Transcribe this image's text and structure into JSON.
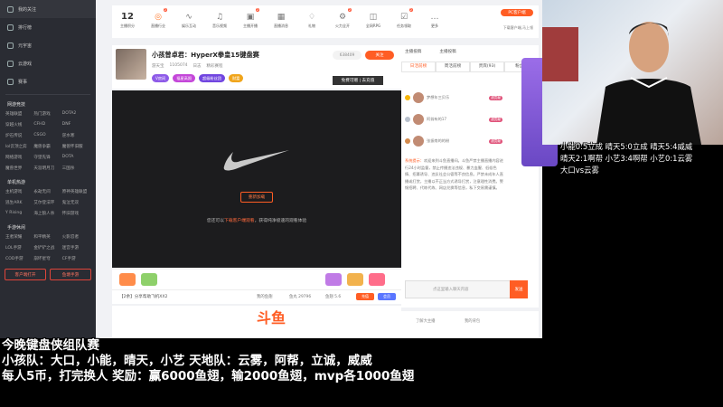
{
  "sidebar": {
    "nav": [
      {
        "label": "我的关注"
      },
      {
        "label": "排行榜"
      },
      {
        "label": "元宇宙"
      },
      {
        "label": "云游戏"
      },
      {
        "label": "赛事"
      }
    ],
    "sections": [
      {
        "title": "网游竞技",
        "items": [
          "英雄联盟",
          "热门游戏",
          "DOTA2",
          "穿越火线",
          "CFHD",
          "DNF",
          "炉石传说",
          "CSGO",
          "逆水寒",
          "lol云顶之弈",
          "魔兽争霸",
          "魔兽怀旧服",
          "网络游戏",
          "守望先锋",
          "DOTA",
          "魔兽世界",
          "天涯明月刀",
          "三国杀"
        ]
      },
      {
        "title": "单机热游",
        "items": [
          "主机游戏",
          "永劫无间",
          "原神英雄联盟",
          "逃生ARK",
          "艾尔登法环",
          "鬼泣无双",
          "Y Rising",
          "海上狼人杀",
          "怀旧游戏"
        ]
      },
      {
        "title": "手游休闲",
        "items": [
          "王者荣耀",
          "和平精英",
          "火影忍者",
          "LOL手游",
          "金铲铲之战",
          "迷宫手游",
          "COD手游",
          "崩坏星穹",
          "CF手游"
        ]
      }
    ],
    "buttons": [
      "客户端打开",
      "鱼塘手游"
    ]
  },
  "topbar": {
    "items": [
      {
        "glyph": "12",
        "label": "主播积分",
        "badge": ""
      },
      {
        "glyph": "◎",
        "label": "直播行业",
        "badge": "2",
        "orange": true
      },
      {
        "glyph": "∿",
        "label": "娱乐互动",
        "badge": ""
      },
      {
        "glyph": "♫",
        "label": "音乐视频",
        "badge": ""
      },
      {
        "glyph": "▣",
        "label": "主播开播",
        "badge": "2"
      },
      {
        "glyph": "▦",
        "label": "直播消息",
        "badge": ""
      },
      {
        "glyph": "♢",
        "label": "礼物",
        "badge": ""
      },
      {
        "glyph": "⚙",
        "label": "火力全开",
        "badge": "2"
      },
      {
        "glyph": "◫",
        "label": "全网RPG",
        "badge": ""
      },
      {
        "glyph": "☑",
        "label": "任务领取",
        "badge": "2"
      },
      {
        "glyph": "…",
        "label": "更多",
        "badge": ""
      }
    ],
    "pc_download": "PC客户端",
    "pc_download_sub": "下载客户端,马上领"
  },
  "room": {
    "title": "小孩曾卓君：HyperX拳皇15键盘赛",
    "sub_items": [
      "游天宝",
      "1105074",
      "日志",
      "精彩赛程"
    ],
    "tags": [
      "V房间",
      "福星高照",
      "超级粉丝团",
      "财富"
    ],
    "fans": "638409",
    "follow": "关注",
    "freegift": "免费可赠 | 去充值"
  },
  "player": {
    "retry": "重新加载",
    "msg_pre": "您还可以",
    "msg_link": "下载客户端观看",
    "msg_post": "，获得纯净极速的观看体验"
  },
  "giftbar": {
    "ticker": "【2余】分享帮助飞机XX2",
    "stats": [
      "我的鱼翅",
      "鱼丸 29796",
      "鱼翅 5.6",
      "充值",
      "会员"
    ]
  },
  "chat": {
    "head": [
      "主播投稿",
      "主播投稿"
    ],
    "tabs": [
      "日活前榜",
      "周活前榜",
      "贵宾(93)",
      "粉丝团"
    ],
    "ranks": [
      {
        "name": "梦想年三贝乐",
        "pill": "超贡献"
      },
      {
        "name": "阿翁有的17",
        "pill": "超贡献"
      },
      {
        "name": "张振南的的粉",
        "pill": "超贡献"
      }
    ],
    "sys_title": "系统提示：",
    "sys_text": "欢迎来到斗鱼直播间。斗鱼严禁主播直播内容进行24小时监督，禁止传播违法违规、暴力血腥、低俗色情、招募诱导、违反社会公德等不良信息。严禁未成年人直播或打赏，主播以不正当方式诱导打赏，注意理性消费。警惕招聘、代练代练、网店兑换等信息，私下交易需谨慎。",
    "input_placeholder": "点这里输入聊天内容",
    "send": "发送",
    "bottom_left": "了解大主播",
    "bottom_mid": "我的背包"
  },
  "ad": {
    "brand": "斗鱼"
  },
  "lyric": [
    "小能0:5立成  晴天5:0立成  晴天5:4威威",
    "晴天2:1啊帮  小艺3:4啊帮  小艺0:1云雾",
    "大口vs云雾"
  ],
  "overlay": [
    "今晚键盘侠组队赛",
    "小孩队：大口，小能，晴天，小艺  天地队：云雾，阿帮，立诚，威威",
    "每人5币，打完换人  奖励：赢6000鱼翅，输2000鱼翅，mvp各1000鱼翅"
  ],
  "colors": {
    "accent": "#ff5d24",
    "sidebar": "#2a2c33",
    "player": "#1c1c1e"
  }
}
